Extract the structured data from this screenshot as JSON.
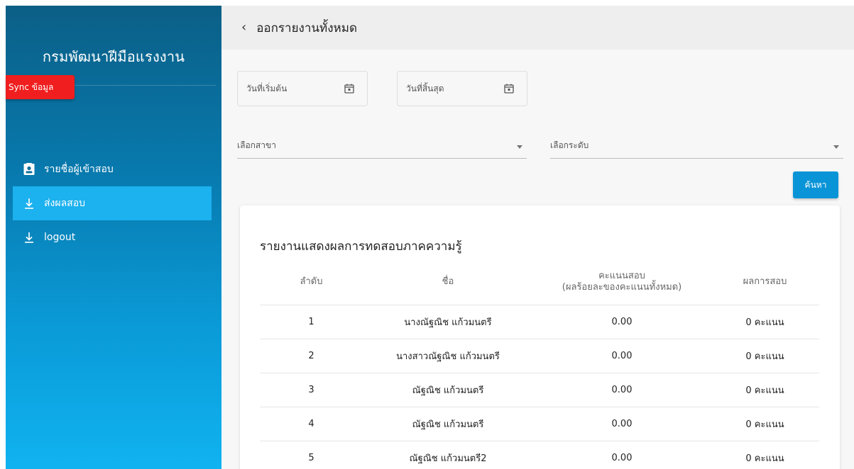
{
  "sidebar": {
    "brand": "กรมพัฒนาฝีมือแรงงาน",
    "sync_label": "Sync ข้อมูล",
    "items": [
      {
        "label": "รายชื่อผู้เข้าสอบ",
        "icon": "id-card-icon",
        "active": false
      },
      {
        "label": "ส่งผลสอบ",
        "icon": "download-icon",
        "active": true
      },
      {
        "label": "logout",
        "icon": "download-icon",
        "active": false
      }
    ],
    "colors": {
      "gradient_top": "#0b5f86",
      "gradient_bottom": "#10b3f0",
      "active_item": "#1cb1ef",
      "sync_button": "#f01e1e"
    }
  },
  "header": {
    "back_icon": "chevron-left-icon",
    "title": "ออกรายงานทั้งหมด"
  },
  "filters": {
    "start_date": {
      "placeholder": "วันที่เริ่มต้น",
      "icon": "calendar-icon"
    },
    "end_date": {
      "placeholder": "วันที่สิ้นสุด",
      "icon": "calendar-icon"
    },
    "branch_select": {
      "placeholder": "เลือกสาขา"
    },
    "level_select": {
      "placeholder": "เลือกระดับ"
    },
    "search_label": "ค้นหา",
    "search_color": "#0a94d8"
  },
  "report": {
    "title": "รายงานแสดงผลการทดสอบภาคความรู้",
    "columns": {
      "no": "ลำดับ",
      "name": "ชื่อ",
      "score_line1": "คะแนนสอบ",
      "score_line2": "(ผลร้อยละของคะแนนทั้งหมด)",
      "result": "ผลการสอบ"
    },
    "rows": [
      {
        "no": "1",
        "name": "นางณัฐณิช แก้วมนตรี",
        "score": "0.00",
        "result": "0 คะแนน"
      },
      {
        "no": "2",
        "name": "นางสาวณัฐณิช แก้วมนตรี",
        "score": "0.00",
        "result": "0 คะแนน"
      },
      {
        "no": "3",
        "name": "ณัฐณิช แก้วมนตรี",
        "score": "0.00",
        "result": "0 คะแนน"
      },
      {
        "no": "4",
        "name": "ณัฐณิช แก้วมนตรี",
        "score": "0.00",
        "result": "0 คะแนน"
      },
      {
        "no": "5",
        "name": "ณัฐณิช แก้วมนตรี2",
        "score": "0.00",
        "result": "0 คะแนน"
      }
    ]
  }
}
